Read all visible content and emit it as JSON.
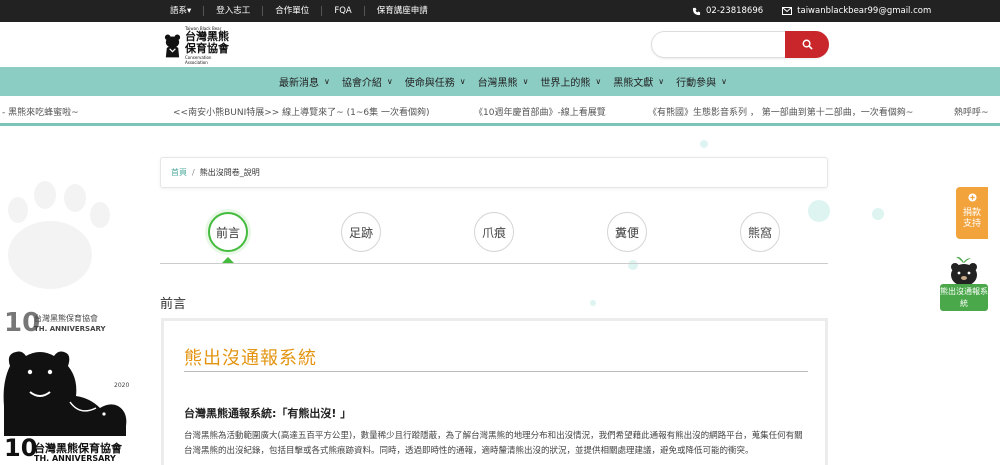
{
  "topbar": {
    "links": [
      "語系▾",
      "登入志工",
      "合作單位",
      "FQA",
      "保育講座申請"
    ],
    "phone": "02-23818696",
    "email": "taiwanblackbear99@gmail.com"
  },
  "logo": {
    "line1": "台灣黑熊",
    "line2": "保育協會",
    "en_top": "Taiwan Black Bear",
    "en_bottom": "Conservation Association"
  },
  "search": {
    "placeholder": ""
  },
  "nav": {
    "items": [
      "最新消息",
      "協會介紹",
      "使命與任務",
      "台灣黑熊",
      "世界上的熊",
      "黑熊文獻",
      "行動參與"
    ]
  },
  "marquee": {
    "items": [
      "- 黑熊來吃蜂蜜啦~",
      "<<南安小熊BUNI特展>> 線上導覽來了~ (1~6集 一次看個夠)",
      "《10週年慶首部曲》-線上看展覽",
      "《有熊國》生態影音系列 ， 第一部曲到第十二部曲，一次看個夠~",
      "熱呼呼~"
    ]
  },
  "breadcrumb": {
    "home": "首頁",
    "sep": "/",
    "current": "熊出沒問卷_說明"
  },
  "tabs": [
    "前言",
    "足跡",
    "爪痕",
    "糞便",
    "熊窩"
  ],
  "section_title": "前言",
  "card": {
    "title": "熊出沒通報系統",
    "subtitle": "台灣黑熊通報系統:「有熊出沒! 」",
    "body": "台灣黑熊為活動範圍廣大(高達五百平方公里)，數量稀少且行蹤隱蔽，為了解台灣黑熊的地理分布和出沒情況，我們希望藉此通報有熊出沒的網路平台，蒐集任何有關台灣黑熊的出沒紀錄，包括目擊或各式熊痕跡資料。同時，透過即時性的通報，適時釐清熊出沒的狀況，並提供相關處理建議，避免或降低可能的衝突。"
  },
  "anniversary": {
    "ten_small": "10",
    "org_small": "台灣黑熊保育協會",
    "anniv_small": "TH. ANNIVERSARY",
    "year": "2020",
    "ten_big": "10",
    "org_big": "台灣黑熊保育協會",
    "anniv_big": "TH. ANNIVERSARY"
  },
  "side": {
    "donate": "捐款支持",
    "report": "熊出沒通報系統"
  },
  "colors": {
    "topbar": "#222222",
    "nav": "#8bccc3",
    "search_btn": "#c9262c",
    "title_orange": "#e39410",
    "active_green": "#44bb3c",
    "donate": "#f2a33c",
    "report": "#4aa84a"
  }
}
